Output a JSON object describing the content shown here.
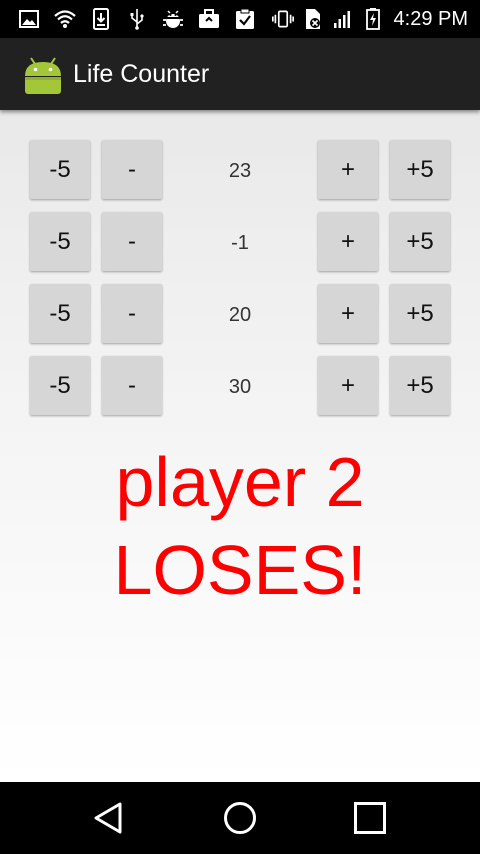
{
  "status_bar": {
    "time": "4:29 PM",
    "icons": [
      "photo-icon",
      "wifi-icon",
      "download-icon",
      "usb-icon",
      "android-debug-icon",
      "briefcase-icon",
      "clipboard-check-icon",
      "vibrate-icon",
      "no-sim-icon",
      "signal-icon",
      "battery-charging-icon"
    ]
  },
  "action_bar": {
    "title": "Life Counter",
    "app_icon": "android-icon"
  },
  "players": [
    {
      "life": "23",
      "minus5": "-5",
      "minus1": "-",
      "plus1": "+",
      "plus5": "+5"
    },
    {
      "life": "-1",
      "minus5": "-5",
      "minus1": "-",
      "plus1": "+",
      "plus5": "+5"
    },
    {
      "life": "20",
      "minus5": "-5",
      "minus1": "-",
      "plus1": "+",
      "plus5": "+5"
    },
    {
      "life": "30",
      "minus5": "-5",
      "minus1": "-",
      "plus1": "+",
      "plus5": "+5"
    }
  ],
  "message": {
    "line1": "player 2",
    "line2": "LOSES!",
    "color": "#ff0000"
  },
  "nav_bar": {
    "buttons": [
      "back-icon",
      "home-icon",
      "recents-icon"
    ]
  }
}
